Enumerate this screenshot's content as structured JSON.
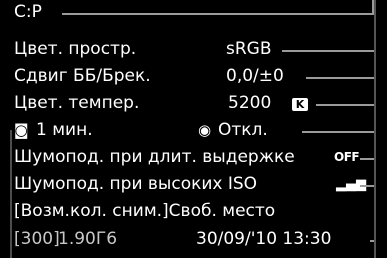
{
  "rows": {
    "mode": "C:P",
    "color_space": {
      "label": "Цвет. простр.",
      "value": "sRGB"
    },
    "wb_shift": {
      "label": "Сдвиг ББ/Брек.",
      "value": "0,0/±0"
    },
    "color_temp": {
      "label": "Цвет. темпер.",
      "value": "5200",
      "unit": "K"
    },
    "auto_power_off": {
      "value": "1 мин."
    },
    "eye_sensor": {
      "value": "Откл."
    },
    "long_exp_nr": {
      "label": "Шумопод. при длит. выдержке",
      "value": "OFF"
    },
    "high_iso_nr": {
      "label": "Шумопод. при высоких ISO"
    },
    "shots_free": {
      "label": "[Возм.кол. сним.]Своб. место"
    },
    "status": {
      "shots": "[300]",
      "free_space": "1.90Г6",
      "datetime": "30/09/'10 13:30"
    }
  },
  "colors": {
    "background": "#000000",
    "text": "#ffffff",
    "rule": "#8a8a8a"
  }
}
